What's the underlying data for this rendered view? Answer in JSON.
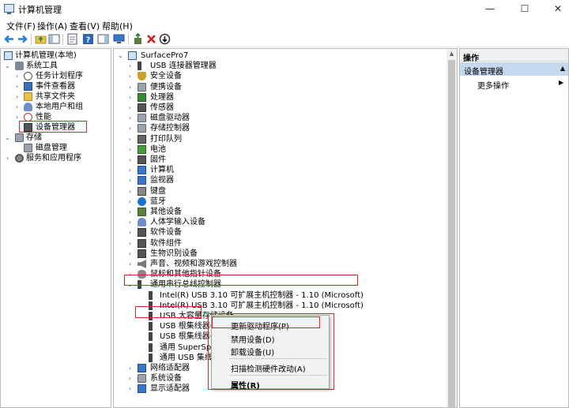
{
  "window": {
    "title": "计算机管理",
    "minimize": "—",
    "maximize": "☐",
    "close": "✕"
  },
  "menu": [
    "文件(F)",
    "操作(A)",
    "查看(V)",
    "帮助(H)"
  ],
  "left_tree": [
    {
      "label": "计算机管理(本地)",
      "icon": "computer-icon"
    },
    {
      "label": "系统工具",
      "icon": "tools-icon"
    },
    {
      "label": "任务计划程序",
      "icon": "clock-icon"
    },
    {
      "label": "事件查看器",
      "icon": "event-viewer-icon"
    },
    {
      "label": "共享文件夹",
      "icon": "shared-folder-icon"
    },
    {
      "label": "本地用户和组",
      "icon": "users-icon"
    },
    {
      "label": "性能",
      "icon": "performance-icon"
    },
    {
      "label": "设备管理器",
      "icon": "device-manager-icon"
    },
    {
      "label": "存储",
      "icon": "storage-icon"
    },
    {
      "label": "磁盘管理",
      "icon": "disk-icon"
    },
    {
      "label": "服务和应用程序",
      "icon": "services-icon"
    }
  ],
  "device_tree": {
    "root": "SurfacePro7",
    "categories": [
      "USB 连接器管理器",
      "安全设备",
      "便携设备",
      "处理器",
      "传感器",
      "磁盘驱动器",
      "存储控制器",
      "打印队列",
      "电池",
      "固件",
      "计算机",
      "监视器",
      "键盘",
      "蓝牙",
      "其他设备",
      "人体学输入设备",
      "软件设备",
      "软件组件",
      "生物识别设备",
      "声音、视频和游戏控制器",
      "鼠标和其他指针设备",
      "通用串行总线控制器"
    ],
    "usb_children": [
      "Intel(R) USB 3.10 可扩展主机控制器 - 1.10 (Microsoft)",
      "Intel(R) USB 3.10 可扩展主机控制器 - 1.10 (Microsoft)",
      "USB 大容量存储设备",
      "USB 根集线器(U",
      "USB 根集线器(U",
      "通用 SuperSpee",
      "通用 USB 集线器"
    ],
    "after": [
      "网络适配器",
      "系统设备",
      "显示适配器"
    ]
  },
  "actions": {
    "header": "操作",
    "section": "设备管理器",
    "more": "更多操作"
  },
  "context_menu": {
    "update_driver": "更新驱动程序(P)",
    "disable": "禁用设备(D)",
    "uninstall": "卸载设备(U)",
    "scan": "扫描检测硬件改动(A)",
    "properties": "属性(R)"
  },
  "colors": {
    "highlight": "#e0202a",
    "selection": "#cce8ff",
    "action_section": "#c5d9ee"
  }
}
